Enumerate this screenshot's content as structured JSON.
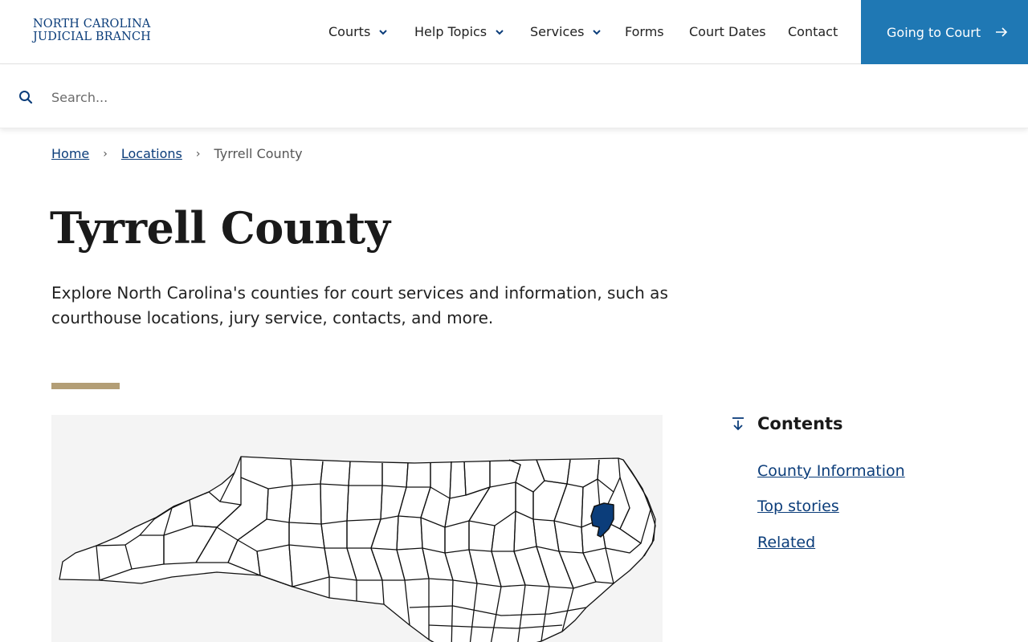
{
  "header": {
    "logo_line1": "NORTH CAROLINA",
    "logo_line2": "JUDICIAL BRANCH",
    "nav": [
      {
        "label": "Courts",
        "has_dropdown": true
      },
      {
        "label": "Help Topics",
        "has_dropdown": true
      },
      {
        "label": "Services",
        "has_dropdown": true
      },
      {
        "label": "Forms",
        "has_dropdown": false
      },
      {
        "label": "Court Dates",
        "has_dropdown": false
      },
      {
        "label": "Contact",
        "has_dropdown": false
      }
    ],
    "cta_label": "Going to Court",
    "colors": {
      "brand": "#0b3d7a",
      "cta": "#1f78b4",
      "accent_rule": "#b39e76",
      "county_highlight": "#0b3d7a"
    }
  },
  "search": {
    "placeholder": "Search...",
    "value": ""
  },
  "breadcrumb": {
    "home": "Home",
    "locations": "Locations",
    "current": "Tyrrell County"
  },
  "page": {
    "title": "Tyrrell County",
    "intro": "Explore North Carolina's counties for court services and information, such as courthouse locations, jury service, contacts, and more."
  },
  "map": {
    "highlighted_county": "Tyrrell County"
  },
  "contents": {
    "title": "Contents",
    "links": [
      "County Information",
      "Top stories",
      "Related"
    ]
  }
}
